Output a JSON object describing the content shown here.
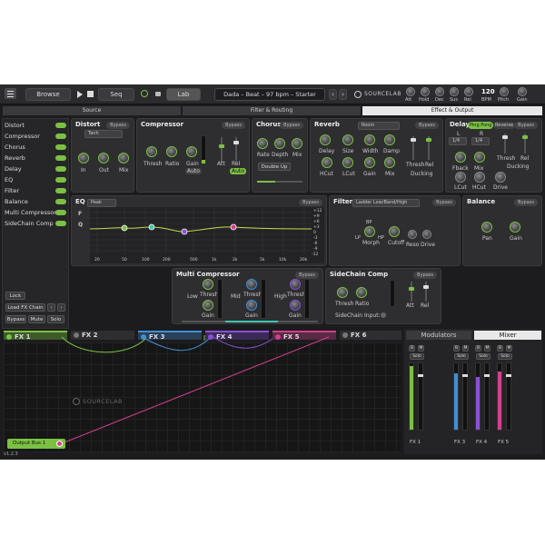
{
  "topbar": {
    "browse": "Browse",
    "seq": "Seq",
    "lab": "Lab",
    "preset": "Dada – Beat – 97 bpm – Starter",
    "logo": "SOURCELAB",
    "knob_labels": [
      "Att",
      "Hold",
      "Dec",
      "Sus",
      "Rel"
    ],
    "bpm_value": "120",
    "bpm_label": "BPM",
    "pitch": "Pitch",
    "gain": "Gain"
  },
  "tabs": {
    "source": "Source",
    "filter": "Filter & Routing",
    "effect": "Effect & Output"
  },
  "sidebar": {
    "items": [
      "Distort",
      "Compressor",
      "Chorus",
      "Reverb",
      "Delay",
      "EQ",
      "Filter",
      "Balance",
      "Multi Compressor",
      "SideChain Comp"
    ],
    "lock": "Lock",
    "load": "Load FX Chain",
    "bypass": "Bypass",
    "mute": "Mute",
    "solo": "Solo"
  },
  "distort": {
    "title": "Distort",
    "bypass": "Bypass",
    "mode": "Tanh",
    "k": [
      "In",
      "Out",
      "Mix"
    ]
  },
  "compressor": {
    "title": "Compressor",
    "bypass": "Bypass",
    "k": [
      "Thresh",
      "Ratio",
      "Gain",
      "Att",
      "Rel"
    ],
    "auto1": "Auto",
    "auto2": "Auto"
  },
  "chorus": {
    "title": "Chorus",
    "bypass": "Bypass",
    "k": [
      "Rate",
      "Depth",
      "Mix"
    ],
    "double": "Double Up"
  },
  "reverb": {
    "title": "Reverb",
    "bypass": "Bypass",
    "room": "Room",
    "k": [
      "Delay",
      "Size",
      "Width",
      "Damp",
      "HCut",
      "LCut",
      "Gain",
      "Mix",
      "Thresh",
      "Rel"
    ],
    "ducking": "Ducking"
  },
  "delay": {
    "title": "Delay",
    "pingpong": "Ping Pong",
    "reverse": "Reverse",
    "bypass": "Bypass",
    "l": "L",
    "r": "R",
    "l_val": "1/4",
    "r_val": "1/4",
    "k": [
      "Fback",
      "Mix",
      "LCut",
      "HCut",
      "Drive",
      "Thresh",
      "Rel"
    ],
    "ducking": "Ducking"
  },
  "eq": {
    "title": "EQ",
    "bypass": "Bypass",
    "mode": "Peak",
    "f": "F",
    "q": "Q",
    "x_ticks": [
      "20",
      "50",
      "100",
      "200",
      "500",
      "1k",
      "2k",
      "5k",
      "10k",
      "20k"
    ],
    "y_ticks": [
      "+12",
      "+9",
      "+6",
      "+3",
      "0",
      "-3",
      "-6",
      "-9",
      "-12"
    ]
  },
  "filter": {
    "title": "Filter",
    "mode": "Ladder Low/Band/High",
    "bypass": "Bypass",
    "bp": "BP",
    "lp": "LP",
    "hp": "HP",
    "k": [
      "Morph",
      "Cutoff",
      "Reso",
      "Drive"
    ]
  },
  "balance": {
    "title": "Balance",
    "bypass": "Bypass",
    "k": [
      "Pan",
      "Gain"
    ]
  },
  "multicomp": {
    "title": "Multi Compressor",
    "bypass": "Bypass",
    "bands": [
      "Low",
      "Mid",
      "High"
    ],
    "thresh": "Thresh",
    "gain": "Gain"
  },
  "sidechain": {
    "title": "SideChain Comp",
    "bypass": "Bypass",
    "k": [
      "Thresh",
      "Ratio",
      "Att",
      "Rel"
    ],
    "input": "SideChain Input:"
  },
  "fx_tabs": [
    "FX 1",
    "FX 2",
    "FX 3",
    "FX 4",
    "FX 5",
    "FX 6"
  ],
  "routing": {
    "logo": "SOURCELAB",
    "output": "Output Bus 1"
  },
  "mixer": {
    "modulators": "Modulators",
    "mixer": "Mixer",
    "b": "B",
    "m": "M",
    "solo": "Solo",
    "channels": [
      "FX 1",
      "FX 3",
      "FX 4",
      "FX 5"
    ]
  },
  "version": "v1.2.3",
  "colors": {
    "green": "#7bc043",
    "blue": "#3f8fd8",
    "purple": "#8a4fd6",
    "pink": "#d23f8c",
    "teal": "#3fc7b0"
  }
}
